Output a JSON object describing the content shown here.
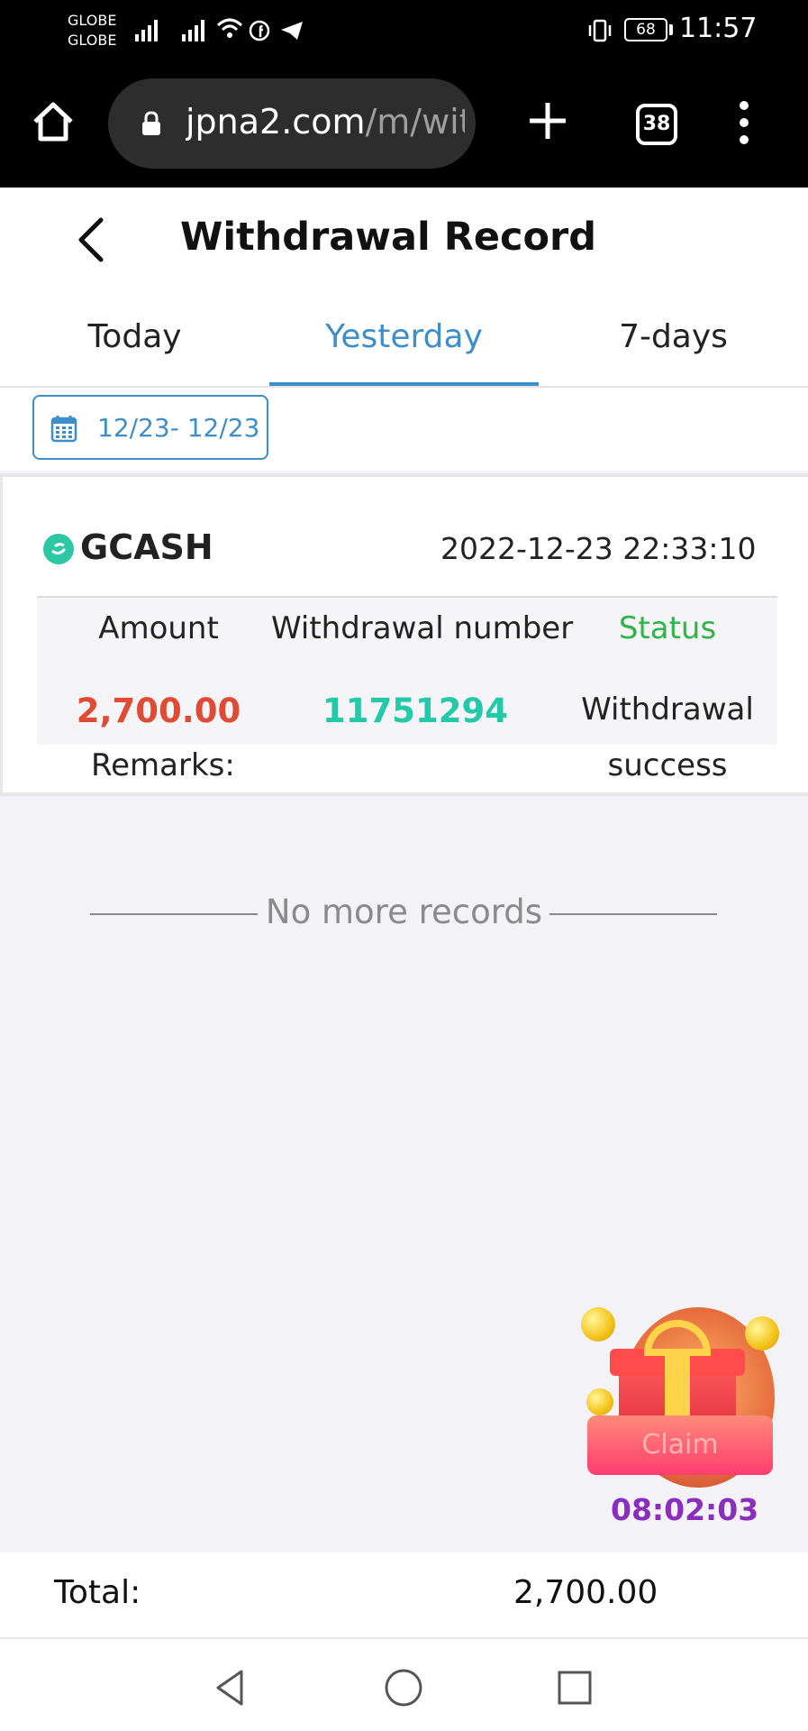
{
  "status_bar": {
    "carrier_1": "GLOBE",
    "carrier_2": "GLOBE",
    "battery": "68",
    "time": "11:57"
  },
  "browser": {
    "url_main": "jpna2.com",
    "url_path": "/m/wit",
    "tab_count": "38"
  },
  "header": {
    "title": "Withdrawal Record"
  },
  "tabs": [
    {
      "label": "Today",
      "active": false
    },
    {
      "label": "Yesterday",
      "active": true
    },
    {
      "label": "7-days",
      "active": false
    }
  ],
  "date_filter": {
    "range": "12/23- 12/23"
  },
  "record": {
    "method": "GCASH",
    "datetime": "2022-12-23 22:33:10",
    "headers": {
      "amount": "Amount",
      "number": "Withdrawal number",
      "status": "Status"
    },
    "amount": "2,700.00",
    "withdrawal_number": "11751294",
    "status_line1": "Withdrawal",
    "status_line2": "success",
    "remarks_label": "Remarks:"
  },
  "list_end": {
    "text": "No more records"
  },
  "gift": {
    "claim_label": "Claim",
    "timer": "08:02:03"
  },
  "total": {
    "label": "Total:",
    "value": "2,700.00"
  },
  "colors": {
    "accent": "#3d8ec9",
    "amount": "#e04b35",
    "number": "#23c9a8",
    "status_header": "#2fb34a",
    "timer": "#8b2dbd"
  }
}
